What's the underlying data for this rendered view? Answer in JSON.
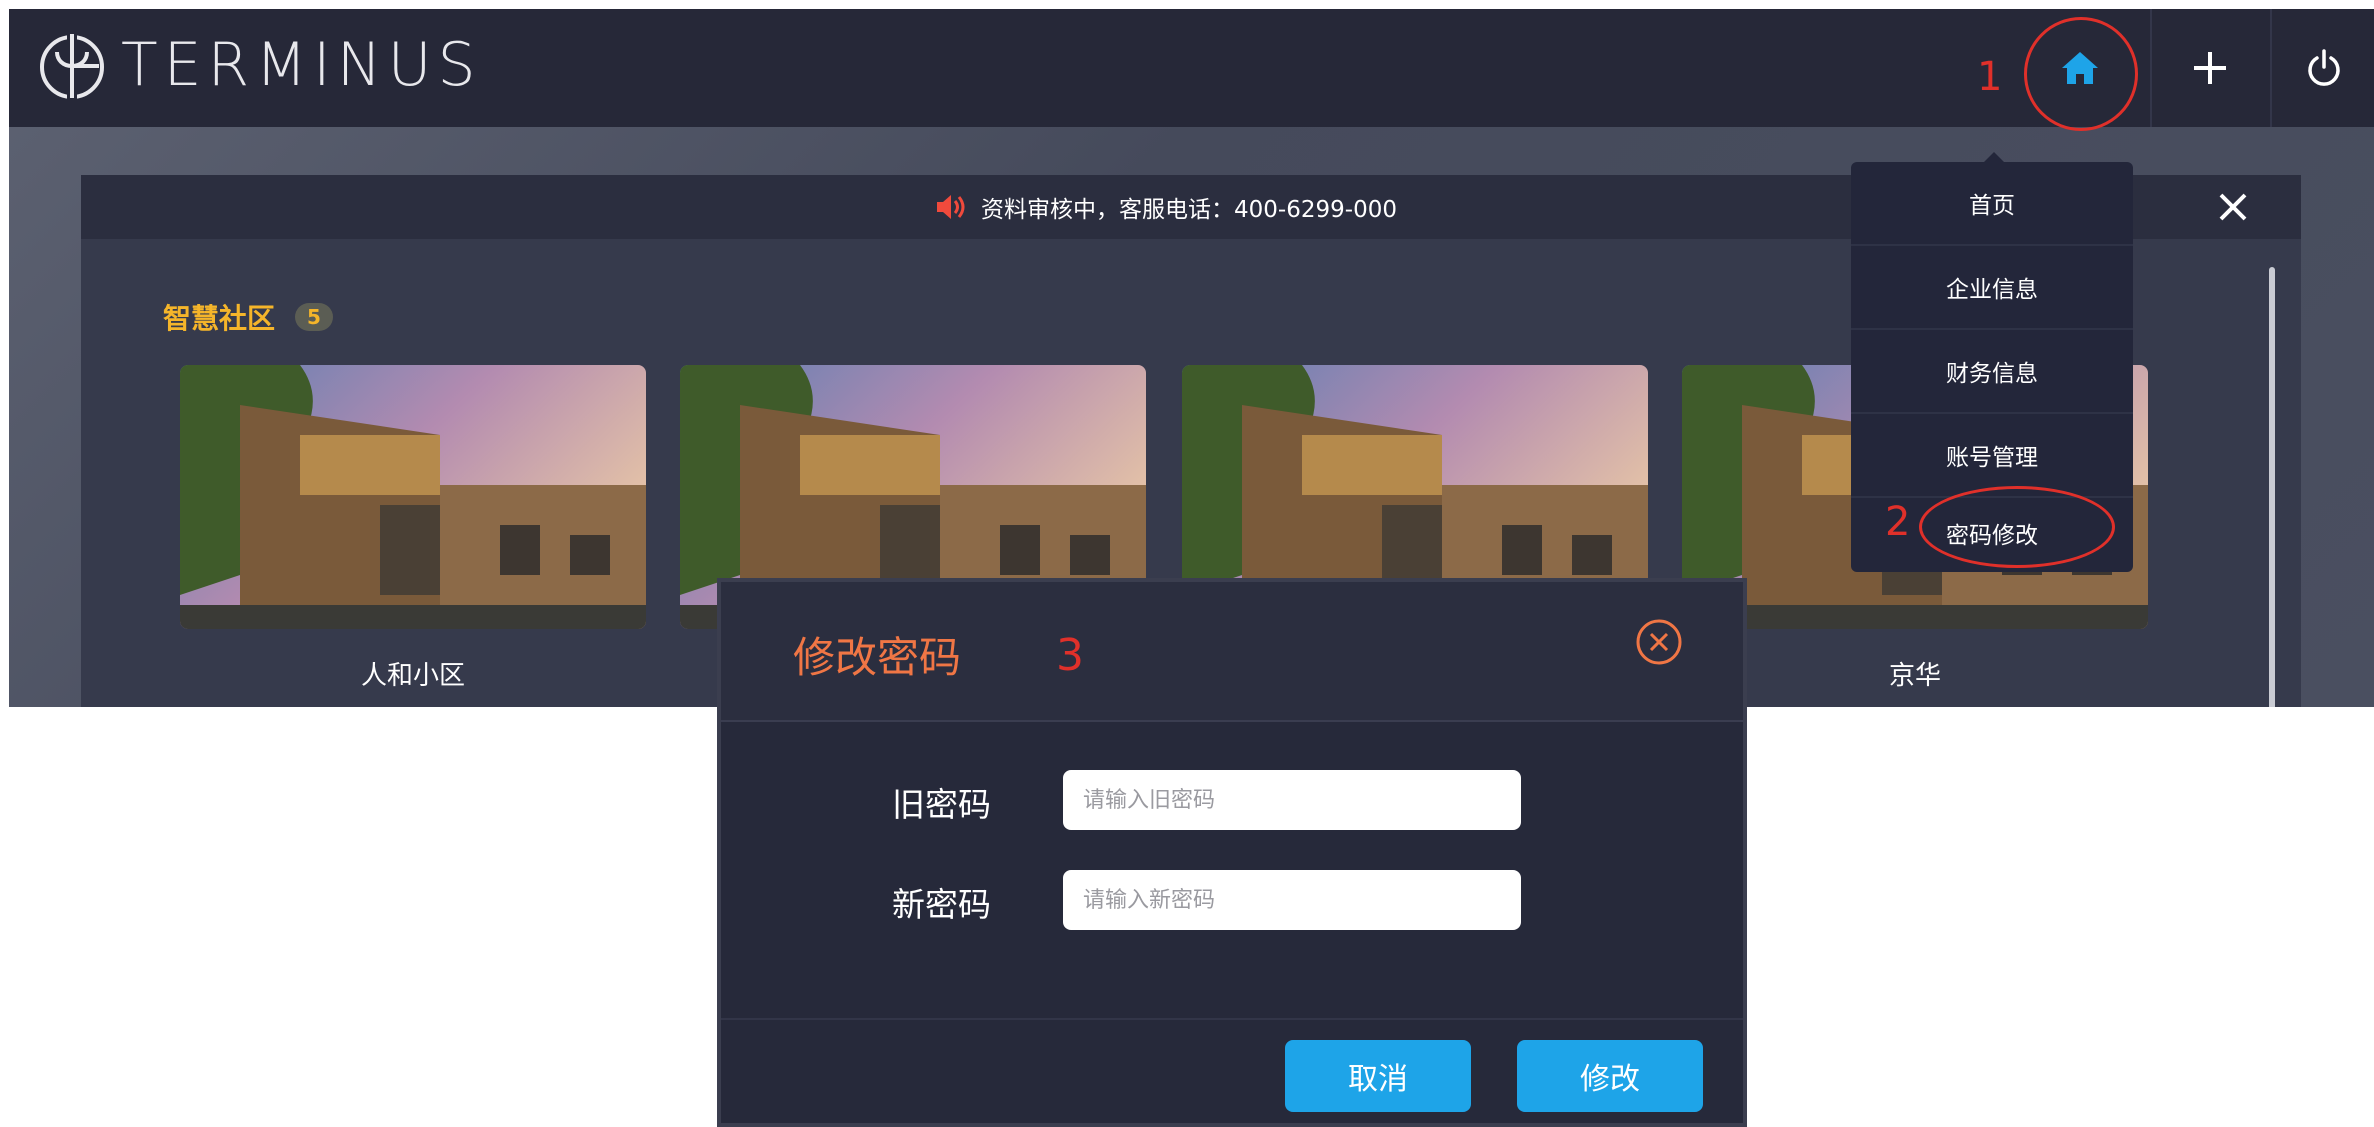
{
  "app": {
    "logo_text": "TERMINUS",
    "nav": {
      "home_icon": "home-icon",
      "add_icon": "plus-icon",
      "power_icon": "power-icon"
    },
    "annotation_1": "1"
  },
  "notice": {
    "text": "资料审核中，客服电话：400-6299-000",
    "icon": "speaker-icon",
    "close_icon": "close-icon"
  },
  "section": {
    "title": "智慧社区",
    "count": "5"
  },
  "communities": [
    {
      "name": "人和小区"
    },
    {
      "name": ""
    },
    {
      "name": ""
    },
    {
      "name": "京华"
    }
  ],
  "dropdown": {
    "items": [
      {
        "label": "首页"
      },
      {
        "label": "企业信息"
      },
      {
        "label": "财务信息"
      },
      {
        "label": "账号管理"
      },
      {
        "label": "密码修改"
      }
    ],
    "annotation_2": "2"
  },
  "modal": {
    "title": "修改密码",
    "annotation_3": "3",
    "old_password": {
      "label": "旧密码",
      "placeholder": "请输入旧密码",
      "value": ""
    },
    "new_password": {
      "label": "新密码",
      "placeholder": "请输入新密码",
      "value": ""
    },
    "cancel_label": "取消",
    "submit_label": "修改"
  },
  "colors": {
    "accent_blue": "#1ea4e8",
    "title_orange": "#f07645",
    "section_yellow": "#f5b52a",
    "annotation_red": "#e0302a"
  }
}
